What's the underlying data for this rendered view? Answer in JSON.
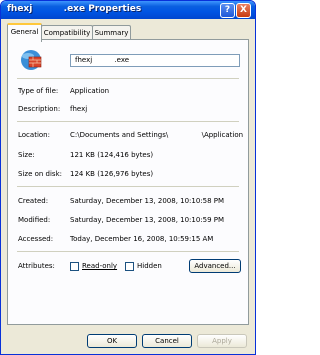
{
  "window": {
    "title": "fhexj          .exe Properties",
    "help_label": "?",
    "close_label": "X"
  },
  "tabs": [
    {
      "label": "General",
      "active": true
    },
    {
      "label": "Compatibility",
      "active": false
    },
    {
      "label": "Summary",
      "active": false
    }
  ],
  "general": {
    "file_name": "fhexj          .exe",
    "icon": "application-icon",
    "type_label": "Type of file:",
    "type_value": "Application",
    "description_label": "Description:",
    "description_value": "fhexj",
    "location_label": "Location:",
    "location_value": "C:\\Documents and Settings\\               \\Application",
    "size_label": "Size:",
    "size_value": "121 KB (124,416 bytes)",
    "size_on_disk_label": "Size on disk:",
    "size_on_disk_value": "124 KB (126,976 bytes)",
    "created_label": "Created:",
    "created_value": "Saturday, December 13, 2008, 10:10:58 PM",
    "modified_label": "Modified:",
    "modified_value": "Saturday, December 13, 2008, 10:10:59 PM",
    "accessed_label": "Accessed:",
    "accessed_value": "Today, December 16, 2008, 10:59:15 AM",
    "attributes_label": "Attributes:",
    "readonly_label": "Read-only",
    "hidden_label": "Hidden",
    "advanced_label": "Advanced..."
  },
  "footer": {
    "ok_label": "OK",
    "cancel_label": "Cancel",
    "apply_label": "Apply"
  },
  "colors": {
    "titlebar": "#0054e3",
    "active_tab_highlight": "#ffc83c",
    "panel_bg": "#fcfcfe",
    "dialog_bg": "#ece9d8"
  }
}
